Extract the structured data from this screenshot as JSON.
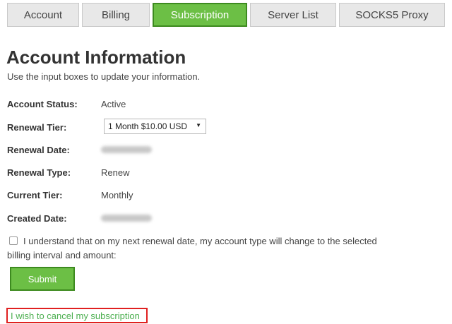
{
  "tabs": [
    {
      "label": "Account",
      "active": false
    },
    {
      "label": "Billing",
      "active": false
    },
    {
      "label": "Subscription",
      "active": true
    },
    {
      "label": "Server List",
      "active": false
    },
    {
      "label": "SOCKS5 Proxy",
      "active": false
    }
  ],
  "page": {
    "title": "Account Information",
    "subtitle": "Use the input boxes to update your information."
  },
  "fields": {
    "account_status": {
      "label": "Account Status:",
      "value": "Active"
    },
    "renewal_tier": {
      "label": "Renewal Tier:",
      "selected": "1 Month $10.00 USD"
    },
    "renewal_date": {
      "label": "Renewal Date:",
      "value_obscured": true
    },
    "renewal_type": {
      "label": "Renewal Type:",
      "value": "Renew"
    },
    "current_tier": {
      "label": "Current Tier:",
      "value": "Monthly"
    },
    "created_date": {
      "label": "Created Date:",
      "value_obscured": true
    }
  },
  "agreement": {
    "checked": false,
    "text": "I understand that on my next renewal date, my account type will change to the selected billing interval and amount:"
  },
  "submit_label": "Submit",
  "cancel_link": "I wish to cancel my subscription",
  "colors": {
    "accent_green": "#6cbf45",
    "accent_border": "#3d8a1f",
    "highlight_red": "#e02020",
    "link_green": "#4caf50"
  },
  "icons": {
    "select_arrow": "triangle-down-icon"
  }
}
